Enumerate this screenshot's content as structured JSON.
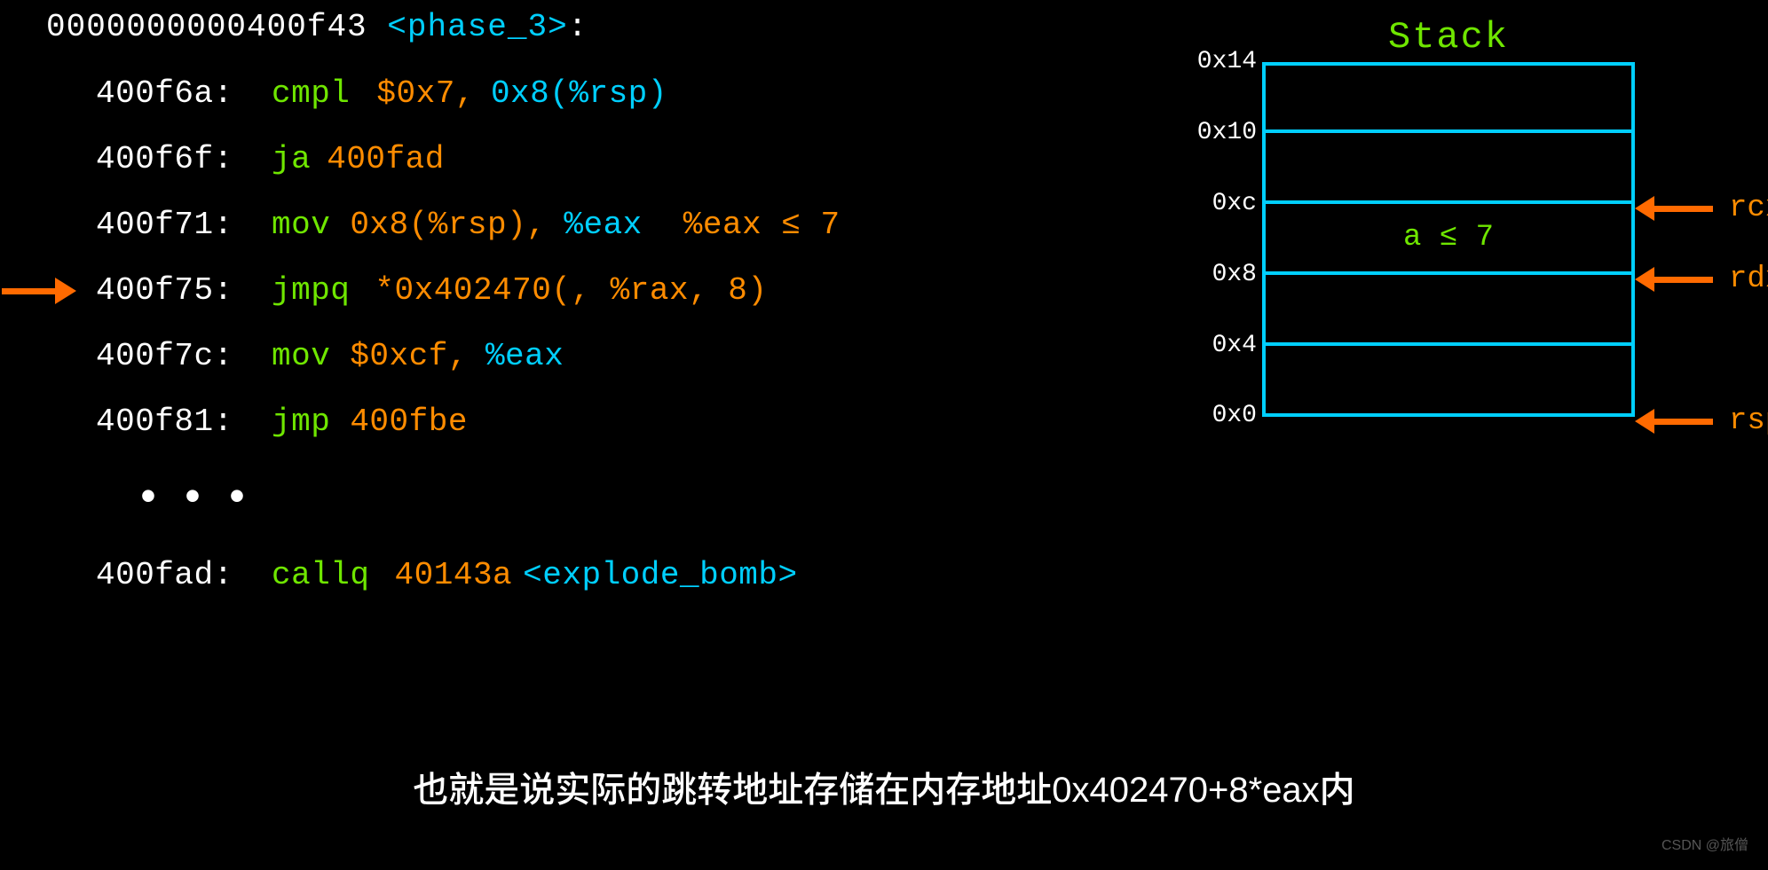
{
  "header": {
    "addr": "0000000000400f43 ",
    "label": "<phase_3>",
    "colon": ":"
  },
  "lines": [
    {
      "addr": "400f6a:",
      "mn": "cmpl",
      "parts": [
        {
          "cls": "sp",
          "w": "30"
        },
        {
          "cls": "orange",
          "t": "$0x7,"
        },
        {
          "cls": "sp",
          "w": "18"
        },
        {
          "cls": "cyan",
          "t": "0x8(%rsp)"
        }
      ]
    },
    {
      "addr": "400f6f:",
      "mn": "ja",
      "parts": [
        {
          "cls": "sp",
          "w": "18"
        },
        {
          "cls": "orange",
          "t": "400fad"
        }
      ]
    },
    {
      "addr": "400f71:",
      "mn": "mov",
      "parts": [
        {
          "cls": "sp",
          "w": "22"
        },
        {
          "cls": "orange",
          "t": "0x8(%rsp),"
        },
        {
          "cls": "sp",
          "w": "20"
        },
        {
          "cls": "cyan",
          "t": "%eax"
        },
        {
          "cls": "sp",
          "w": "46"
        },
        {
          "cls": "orange",
          "t": "%eax ≤ 7"
        }
      ]
    },
    {
      "addr": "400f75:",
      "mn": "jmpq",
      "parts": [
        {
          "cls": "sp",
          "w": "28"
        },
        {
          "cls": "orange",
          "t": "*0x402470(, %rax, 8)"
        }
      ]
    },
    {
      "addr": "400f7c:",
      "mn": "mov",
      "parts": [
        {
          "cls": "sp",
          "w": "22"
        },
        {
          "cls": "orange",
          "t": "$0xcf,"
        },
        {
          "cls": "sp",
          "w": "20"
        },
        {
          "cls": "cyan",
          "t": "%eax"
        }
      ]
    },
    {
      "addr": "400f81:",
      "mn": "jmp",
      "parts": [
        {
          "cls": "sp",
          "w": "22"
        },
        {
          "cls": "orange",
          "t": "400fbe"
        }
      ]
    }
  ],
  "dots": "•••",
  "final_line": {
    "addr": "400fad:",
    "mn": "callq",
    "parts": [
      {
        "cls": "sp",
        "w": "28"
      },
      {
        "cls": "orange",
        "t": "40143a"
      },
      {
        "cls": "sp",
        "w": "12"
      },
      {
        "cls": "cyan",
        "t": "<explode_bomb>"
      }
    ]
  },
  "pointer_index": 3,
  "stack": {
    "title": "Stack",
    "offsets": [
      "0x14",
      "0x10",
      "0xc",
      "0x8",
      "0x4",
      "0x0"
    ],
    "cells": [
      "",
      "",
      "",
      "a ≤ 7",
      "",
      ""
    ],
    "pointers": [
      {
        "offset": "0xc",
        "reg": "rcx"
      },
      {
        "offset": "0x8",
        "reg": "rdx"
      },
      {
        "offset": "0x0",
        "reg": "rsp"
      }
    ]
  },
  "caption": "也就是说实际的跳转地址存储在内存地址0x402470+8*eax内",
  "watermark": "CSDN @旅僧"
}
